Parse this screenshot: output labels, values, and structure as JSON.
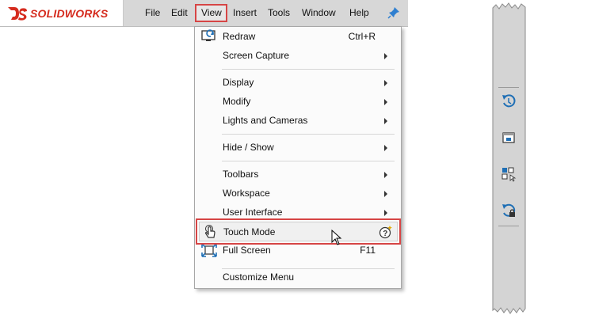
{
  "app": {
    "logo_text": "SOLIDWORKS",
    "brand_color": "#d52b1e"
  },
  "menubar": {
    "items": [
      "File",
      "Edit",
      "View",
      "Insert",
      "Tools",
      "Window",
      "Help"
    ],
    "pin_icon": "pin-icon"
  },
  "view_menu": {
    "items": [
      {
        "label": "Redraw",
        "shortcut": "Ctrl+R",
        "icon": "redraw-icon"
      },
      {
        "label": "Screen Capture",
        "submenu": true
      },
      {
        "label": "Display",
        "submenu": true
      },
      {
        "label": "Modify",
        "submenu": true
      },
      {
        "label": "Lights and Cameras",
        "submenu": true
      },
      {
        "label": "Hide / Show",
        "submenu": true
      },
      {
        "label": "Toolbars",
        "submenu": true
      },
      {
        "label": "Workspace",
        "submenu": true
      },
      {
        "label": "User Interface",
        "submenu": true
      },
      {
        "label": "Touch Mode",
        "icon": "touch-hand-icon",
        "badge_icon": "help-sparkle-icon",
        "highlighted": true
      },
      {
        "label": "Full Screen",
        "shortcut": "F11",
        "icon": "full-screen-icon"
      },
      {
        "label": "Customize Menu"
      }
    ]
  },
  "right_toolbar": {
    "icons": [
      "rotate-view-icon",
      "view-window-icon",
      "view-selector-icon",
      "locked-rotate-icon"
    ]
  },
  "colors": {
    "highlight_border": "#d64545",
    "icon_blue": "#1f6fb5"
  }
}
